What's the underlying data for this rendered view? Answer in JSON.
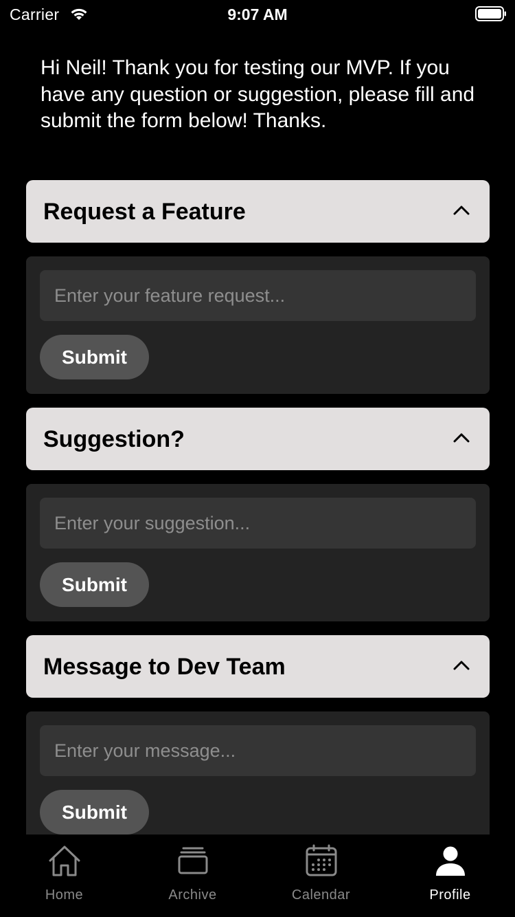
{
  "status_bar": {
    "carrier": "Carrier",
    "time": "9:07 AM"
  },
  "intro": {
    "text": "Hi Neil! Thank you for testing our MVP. If you have any question or suggestion, please fill and submit the form below! Thanks."
  },
  "sections": [
    {
      "title": "Request a Feature",
      "placeholder": "Enter your feature request...",
      "submit_label": "Submit"
    },
    {
      "title": "Suggestion?",
      "placeholder": "Enter your suggestion...",
      "submit_label": "Submit"
    },
    {
      "title": "Message to Dev Team",
      "placeholder": "Enter your message...",
      "submit_label": "Submit"
    }
  ],
  "tab_bar": {
    "tabs": [
      {
        "label": "Home",
        "icon": "home-icon"
      },
      {
        "label": "Archive",
        "icon": "archive-icon"
      },
      {
        "label": "Calendar",
        "icon": "calendar-icon"
      },
      {
        "label": "Profile",
        "icon": "profile-icon"
      }
    ],
    "active": "Profile"
  },
  "colors": {
    "background": "#000000",
    "section_header": "#e2dfdf",
    "section_body": "#232323",
    "input": "#353535",
    "button": "#545454",
    "tab_inactive": "#8a8a8a",
    "tab_active": "#ffffff"
  }
}
